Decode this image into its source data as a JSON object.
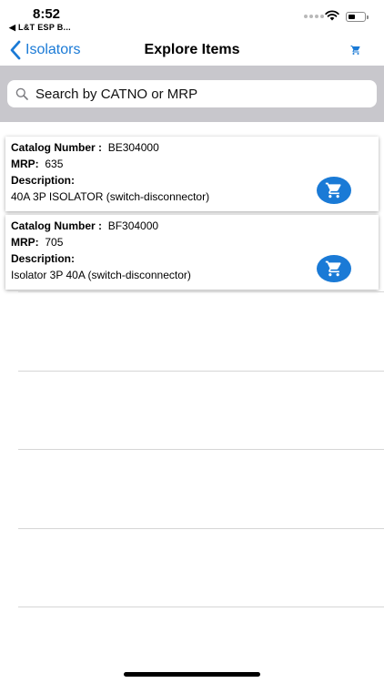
{
  "status_bar": {
    "time": "8:52",
    "back_app": "◀ L&T ESP  B..."
  },
  "nav": {
    "back_label": "Isolators",
    "title": "Explore Items",
    "accent_color": "#1a7ad6"
  },
  "search": {
    "placeholder": "Search by CATNO or MRP"
  },
  "labels": {
    "catalog_number": "Catalog Number :",
    "mrp": "MRP:",
    "description": "Description:"
  },
  "items": [
    {
      "catalog_number": "BE304000",
      "mrp": "635",
      "description": "40A 3P ISOLATOR (switch-disconnector)"
    },
    {
      "catalog_number": "BF304000",
      "mrp": "705",
      "description": "Isolator 3P 40A (switch-disconnector)"
    }
  ],
  "icons": {
    "back": "chevron-left-icon",
    "cart": "shopping-cart-icon",
    "search": "magnifier-icon"
  }
}
